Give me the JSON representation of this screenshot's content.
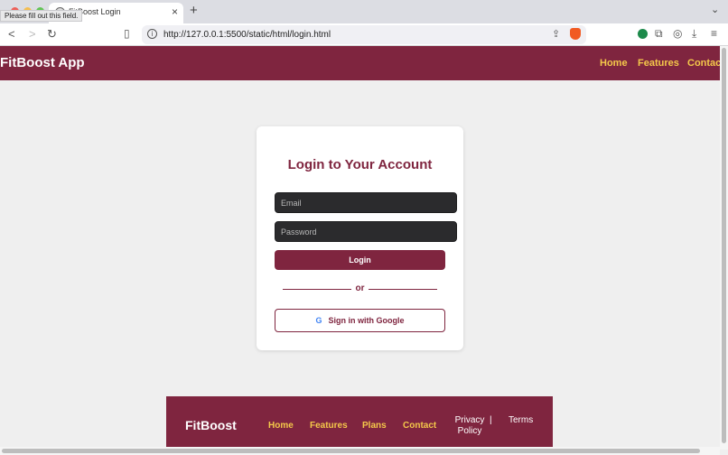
{
  "browser": {
    "tab_title": "FitBoost Login",
    "tooltip": "Please fill out this field.",
    "url": "http://127.0.0.1:5500/static/html/login.html",
    "new_tab_label": "+",
    "close_tab_label": "×"
  },
  "header": {
    "logo": "FitBoost App",
    "nav": [
      "Home",
      "Features",
      "Contact"
    ]
  },
  "login": {
    "title": "Login to Your Account",
    "email_placeholder": "Email",
    "password_placeholder": "Password",
    "login_label": "Login",
    "divider": "or",
    "google_label": "Sign in with Google"
  },
  "footer": {
    "logo": "FitBoost",
    "links": [
      "Home",
      "Features",
      "Plans",
      "Contact"
    ],
    "privacy": "Privacy Policy",
    "separator": "|",
    "terms": "Terms"
  },
  "colors": {
    "brand": "#7f253f",
    "nav_link": "#f4c84a",
    "page_bg": "#efefef"
  }
}
